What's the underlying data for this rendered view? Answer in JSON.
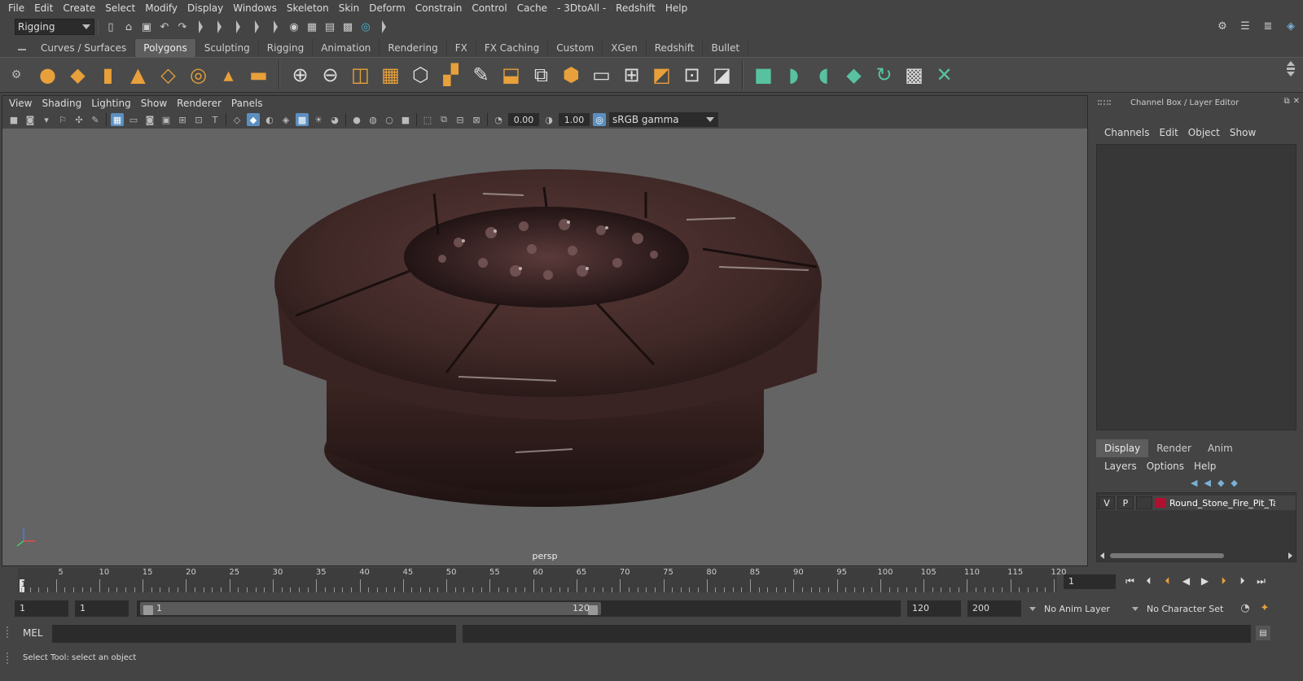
{
  "menubar": [
    "File",
    "Edit",
    "Create",
    "Select",
    "Modify",
    "Display",
    "Windows",
    "Skeleton",
    "Skin",
    "Deform",
    "Constrain",
    "Control",
    "Cache",
    "- 3DtoAll -",
    "Redshift",
    "Help"
  ],
  "statusline": {
    "mode": "Rigging"
  },
  "shelf_tabs": [
    "Curves / Surfaces",
    "Polygons",
    "Sculpting",
    "Rigging",
    "Animation",
    "Rendering",
    "FX",
    "FX Caching",
    "Custom",
    "XGen",
    "Redshift",
    "Bullet"
  ],
  "shelf_active": "Polygons",
  "panel_menu": [
    "View",
    "Shading",
    "Lighting",
    "Show",
    "Renderer",
    "Panels"
  ],
  "panel_tools": {
    "exposure": "0.00",
    "gamma": "1.00",
    "color_space": "sRGB gamma"
  },
  "viewport": {
    "camera_label": "persp"
  },
  "channel_box": {
    "title": "Channel Box / Layer Editor",
    "menu": [
      "Channels",
      "Edit",
      "Object",
      "Show"
    ]
  },
  "layer_editor": {
    "tabs": [
      "Display",
      "Render",
      "Anim"
    ],
    "active_tab": "Display",
    "menu": [
      "Layers",
      "Options",
      "Help"
    ],
    "layers": [
      {
        "visible": "V",
        "playback": "P",
        "name": "Round_Stone_Fire_Pit_Ta",
        "color": "#b01030"
      }
    ]
  },
  "timeslider": {
    "ticks": [
      5,
      10,
      15,
      20,
      25,
      30,
      35,
      40,
      45,
      50,
      55,
      60,
      65,
      70,
      75,
      80,
      85,
      90,
      95,
      100,
      105,
      110,
      115,
      120
    ],
    "start": 1,
    "end": 120,
    "current_frame_marker": "1",
    "current_frame": "1"
  },
  "rangeslider": {
    "start_time": "1",
    "playback_start": "1",
    "range_start_label": "1",
    "range_end_label": "120",
    "playback_end": "120",
    "end_time": "200",
    "anim_layer": "No Anim Layer",
    "character_set": "No Character Set"
  },
  "cmdline": {
    "label": "MEL"
  },
  "helpline": {
    "text": "Select Tool: select an object"
  }
}
